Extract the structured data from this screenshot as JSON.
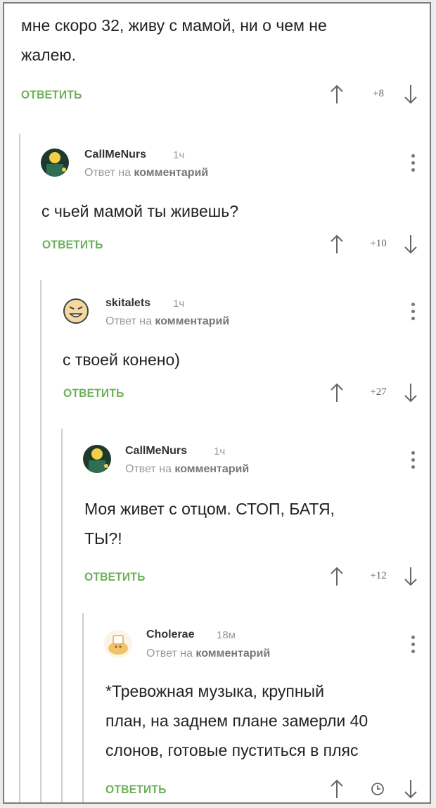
{
  "colors": {
    "reply": "#6db05a",
    "text": "#222222",
    "muted": "#9a9a9a",
    "thread_line": "#cfcfcf"
  },
  "top": {
    "text_lines": [
      "мне скоро 32, живу с мамой, ни о чем не",
      "жалею."
    ],
    "reply": "ОТВЕТИТЬ",
    "score": "+8"
  },
  "c1": {
    "author": "CallMeNurs",
    "time": "1ч",
    "sub_prefix": "Ответ на",
    "sub_link": "комментарий",
    "text_lines": [
      "с чьей мамой ты живешь?"
    ],
    "reply": "ОТВЕТИТЬ",
    "score": "+10"
  },
  "c2": {
    "author": "skitalets",
    "time": "1ч",
    "sub_prefix": "Ответ на",
    "sub_link": "комментарий",
    "text_lines": [
      "с твоей конено)"
    ],
    "reply": "ОТВЕТИТЬ",
    "score": "+27"
  },
  "c3": {
    "author": "CallMeNurs",
    "time": "1ч",
    "sub_prefix": "Ответ на",
    "sub_link": "комментарий",
    "text_lines": [
      "Моя живет с отцом. СТОП, БАТЯ,",
      "ТЫ?!"
    ],
    "reply": "ОТВЕТИТЬ",
    "score": "+12"
  },
  "c4": {
    "author": "Cholerae",
    "time": "18м",
    "sub_prefix": "Ответ на",
    "sub_link": "комментарий",
    "text_lines": [
      "*Тревожная музыка, крупный",
      "план, на заднем плане замерли 40",
      "слонов, готовые пуститься в пляс"
    ],
    "reply": "ОТВЕТИТЬ",
    "score_icon": "clock-icon"
  }
}
